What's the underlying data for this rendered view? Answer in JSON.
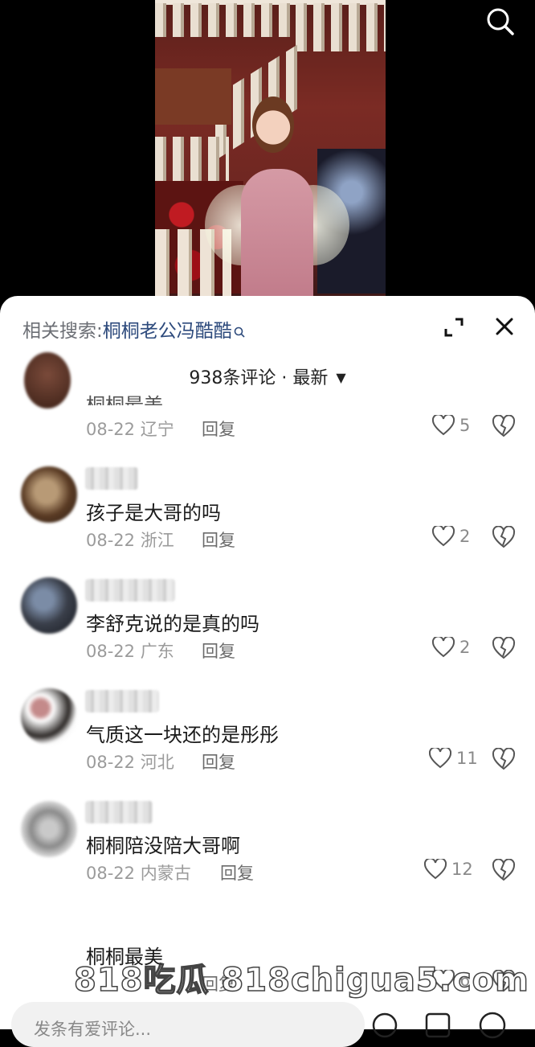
{
  "header": {
    "search_icon": "search-icon"
  },
  "sheet": {
    "related_label": "相关搜索:",
    "related_keyword": "桐桐老公冯酷酷",
    "comment_count": "938条评论",
    "sort_separator": "·",
    "sort_label": "最新",
    "sort_arrow": "▼"
  },
  "comments": [
    {
      "text": "",
      "date": "08-22",
      "region": "辽宁",
      "reply": "回复",
      "likes": "5"
    },
    {
      "text": "孩子是大哥的吗",
      "date": "08-22",
      "region": "浙江",
      "reply": "回复",
      "likes": "2"
    },
    {
      "text": "李舒克说的是真的吗",
      "date": "08-22",
      "region": "广东",
      "reply": "回复",
      "likes": "2"
    },
    {
      "text": "气质这一块还的是彤彤",
      "date": "08-22",
      "region": "河北",
      "reply": "回复",
      "likes": "11"
    },
    {
      "text": "桐桐陪没陪大哥啊",
      "date": "08-22",
      "region": "内蒙古",
      "reply": "回复",
      "likes": "12"
    },
    {
      "text": "桐桐最美",
      "date": "",
      "region": "",
      "reply": "回复",
      "likes": "6"
    }
  ],
  "input": {
    "placeholder": "发条有爱评论..."
  },
  "watermark": "818吃瓜 818chigua5.com",
  "colors": {
    "accent_link": "#2d4a7c",
    "sheet_bg": "#ffffff",
    "page_bg": "#000000"
  }
}
